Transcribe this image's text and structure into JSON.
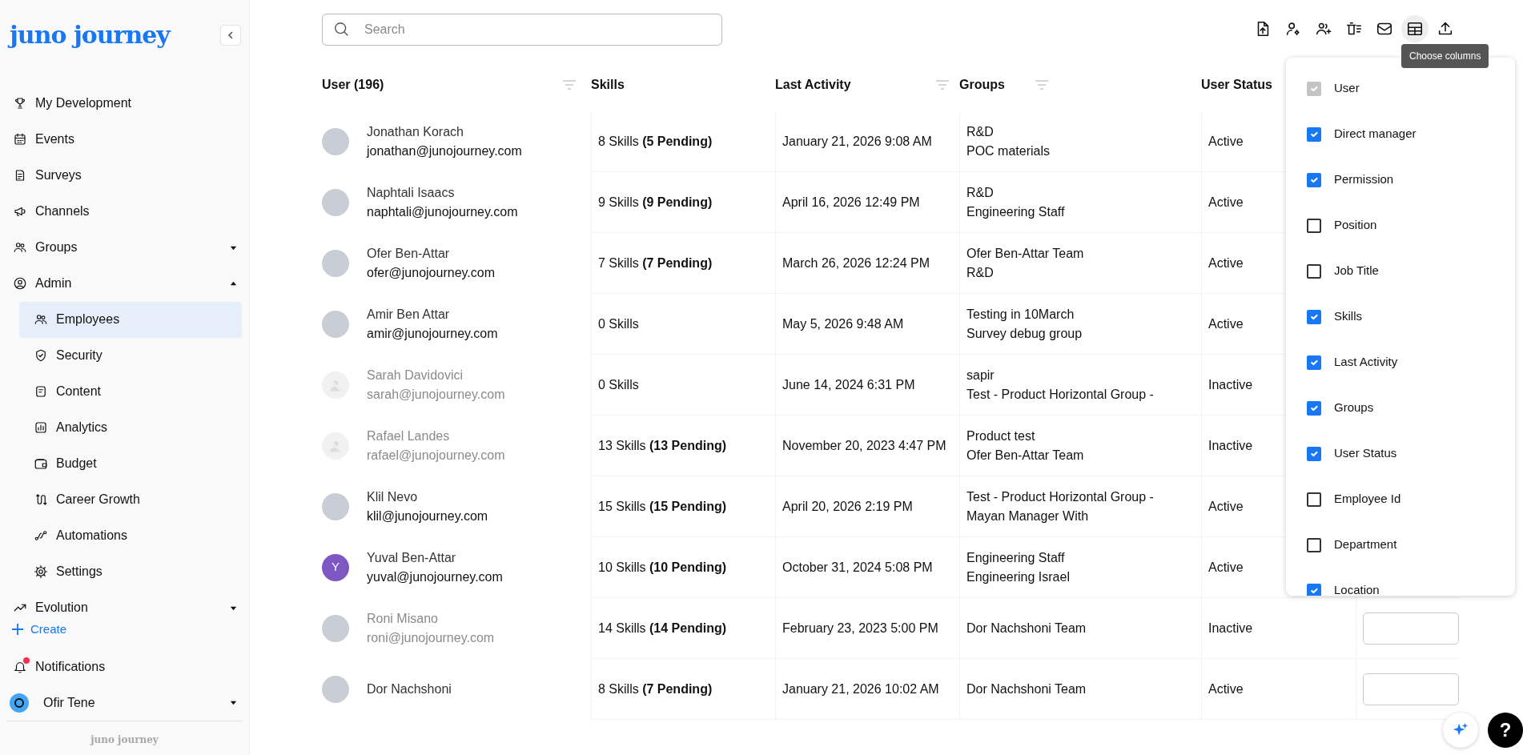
{
  "sidebar": {
    "logo": "juno journey",
    "items": [
      {
        "label": "My Development",
        "selected": false
      },
      {
        "label": "Events",
        "selected": false
      },
      {
        "label": "Surveys",
        "selected": false
      },
      {
        "label": "Channels",
        "selected": false
      },
      {
        "label": "Groups",
        "selected": false,
        "expanded": false
      },
      {
        "label": "Admin",
        "selected": false,
        "expanded": true,
        "children": [
          {
            "label": "Employees",
            "selected": true
          },
          {
            "label": "Security",
            "selected": false
          },
          {
            "label": "Content",
            "selected": false
          },
          {
            "label": "Analytics",
            "selected": false
          },
          {
            "label": "Budget",
            "selected": false
          },
          {
            "label": "Career Growth",
            "selected": false
          },
          {
            "label": "Automations",
            "selected": false
          },
          {
            "label": "Settings",
            "selected": false
          }
        ]
      },
      {
        "label": "Evolution",
        "selected": false,
        "expanded": false
      }
    ],
    "create": "Create",
    "notifications": {
      "label": "Notifications",
      "unread": true
    },
    "user": {
      "name": "Ofir Tene"
    },
    "footer_logo": "juno journey"
  },
  "search": {
    "placeholder": "Search"
  },
  "toolbar": {
    "buttons": [
      {
        "selected": false
      },
      {
        "selected": false
      },
      {
        "selected": false
      },
      {
        "selected": false
      },
      {
        "selected": false
      },
      {
        "selected": true
      },
      {
        "selected": false
      }
    ],
    "tooltip": "Choose columns"
  },
  "table": {
    "columns": [
      {
        "label": "User (196)",
        "filter": true
      },
      {
        "label": "Skills",
        "filter": false
      },
      {
        "label": "Last Activity",
        "filter": true
      },
      {
        "label": "Groups",
        "filter": true
      },
      {
        "label": "User Status",
        "filter": false
      }
    ],
    "rows": [
      {
        "avatar": {
          "kind": "photo"
        },
        "dimmed": false,
        "name": "Jonathan Korach",
        "email": "jonathan@junojourney.com",
        "skills": "8 Skills **(5 Pending)**",
        "last_activity": "January 21, 2026 9:08 AM",
        "groups": [
          "R&D",
          "POC materials"
        ],
        "status": "Active"
      },
      {
        "avatar": {
          "kind": "photo"
        },
        "dimmed": false,
        "name": "Naphtali Isaacs",
        "email": "naphtali@junojourney.com",
        "skills": "9 Skills **(9 Pending)**",
        "last_activity": "April 16, 2026 12:49 PM",
        "groups": [
          "R&D",
          "Engineering Staff"
        ],
        "status": "Active"
      },
      {
        "avatar": {
          "kind": "photo"
        },
        "dimmed": false,
        "name": "Ofer Ben-Attar",
        "email": "ofer@junojourney.com",
        "skills": "7 Skills **(7 Pending)**",
        "last_activity": "March 26, 2026 12:24 PM",
        "groups": [
          "Ofer Ben-Attar Team",
          "R&D"
        ],
        "status": "Active"
      },
      {
        "avatar": {
          "kind": "photo"
        },
        "dimmed": false,
        "name": "Amir Ben Attar",
        "email": "amir@junojourney.com",
        "skills": "0 Skills",
        "last_activity": "May 5, 2026 9:48 AM",
        "groups": [
          "Testing in 10March",
          "Survey debug group"
        ],
        "status": "Active"
      },
      {
        "avatar": {
          "kind": "placeholder"
        },
        "dimmed": true,
        "name": "Sarah Davidovici",
        "email": "sarah@junojourney.com",
        "skills": "0 Skills",
        "last_activity": "June 14, 2024 6:31 PM",
        "groups": [
          "sapir",
          "Test - Product Horizontal Group -"
        ],
        "status": "Inactive"
      },
      {
        "avatar": {
          "kind": "placeholder"
        },
        "dimmed": true,
        "name": "Rafael Landes",
        "email": "rafael@junojourney.com",
        "skills": "13 Skills **(13 Pending)**",
        "last_activity": "November 20, 2023 4:47 PM",
        "groups": [
          "Product test",
          "Ofer Ben-Attar Team"
        ],
        "status": "Inactive"
      },
      {
        "avatar": {
          "kind": "photo"
        },
        "dimmed": false,
        "name": "Klil Nevo",
        "email": "klil@junojourney.com",
        "skills": "15 Skills **(15 Pending)**",
        "last_activity": "April 20, 2026 2:19 PM",
        "groups": [
          "Test - Product Horizontal Group -",
          "Mayan Manager With"
        ],
        "status": "Active"
      },
      {
        "avatar": {
          "kind": "initial",
          "initial": "Y",
          "color": "#7e57c2"
        },
        "dimmed": false,
        "name": "Yuval Ben-Attar",
        "email": "yuval@junojourney.com",
        "skills": "10 Skills **(10 Pending)**",
        "last_activity": "October 31, 2024 5:08 PM",
        "groups": [
          "Engineering Staff",
          "Engineering Israel"
        ],
        "status": "Active"
      },
      {
        "avatar": {
          "kind": "photo"
        },
        "dimmed": true,
        "name": "Roni Misano",
        "email": "roni@junojourney.com",
        "skills": "14 Skills **(14 Pending)**",
        "last_activity": "February 23, 2023 5:00 PM",
        "groups": [
          "Dor Nachshoni Team"
        ],
        "status": "Inactive"
      },
      {
        "avatar": {
          "kind": "photo"
        },
        "dimmed": false,
        "name": "Dor Nachshoni",
        "skills": "8 Skills **(7 Pending)**",
        "last_activity": "January 21, 2026 10:02 AM",
        "groups": [
          "Dor Nachshoni Team"
        ],
        "status": "Active"
      }
    ]
  },
  "column_picker": {
    "options": [
      {
        "label": "User",
        "checked": true,
        "disabled": true
      },
      {
        "label": "Direct manager",
        "checked": true,
        "disabled": false
      },
      {
        "label": "Permission",
        "checked": true,
        "disabled": false
      },
      {
        "label": "Position",
        "checked": false,
        "disabled": false
      },
      {
        "label": "Job Title",
        "checked": false,
        "disabled": false
      },
      {
        "label": "Skills",
        "checked": true,
        "disabled": false
      },
      {
        "label": "Last Activity",
        "checked": true,
        "disabled": false
      },
      {
        "label": "Groups",
        "checked": true,
        "disabled": false
      },
      {
        "label": "User Status",
        "checked": true,
        "disabled": false
      },
      {
        "label": "Employee Id",
        "checked": false,
        "disabled": false
      },
      {
        "label": "Department",
        "checked": false,
        "disabled": false
      },
      {
        "label": "Location",
        "checked": true,
        "disabled": false
      }
    ]
  },
  "help": {
    "label": "?"
  }
}
